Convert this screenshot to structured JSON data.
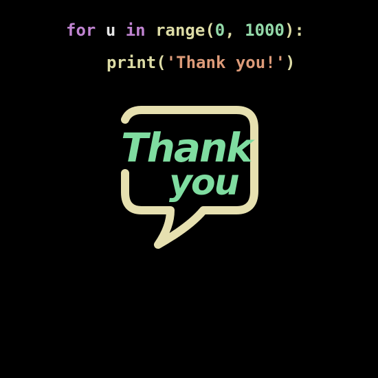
{
  "code": {
    "line1": {
      "kw_for": "for",
      "var_u": "u",
      "kw_in": "in",
      "func_range": "range",
      "open_paren": "(",
      "num_start": "0",
      "comma": ", ",
      "num_end": "1000",
      "close_colon": "):"
    },
    "line2": {
      "func_print": "print",
      "open_paren": "(",
      "string": "'Thank you!'",
      "close_paren": ")"
    }
  },
  "bubble": {
    "line1": "Thank",
    "line2": "you"
  },
  "colors": {
    "background": "#000000",
    "keyword": "#c084d1",
    "function": "#dddca6",
    "number": "#93d9a9",
    "string": "#dd9b79",
    "bubble_outline": "#e6e0b0",
    "bubble_text": "#7fdca0"
  },
  "icons": {
    "bubble": "speech-bubble-icon"
  }
}
